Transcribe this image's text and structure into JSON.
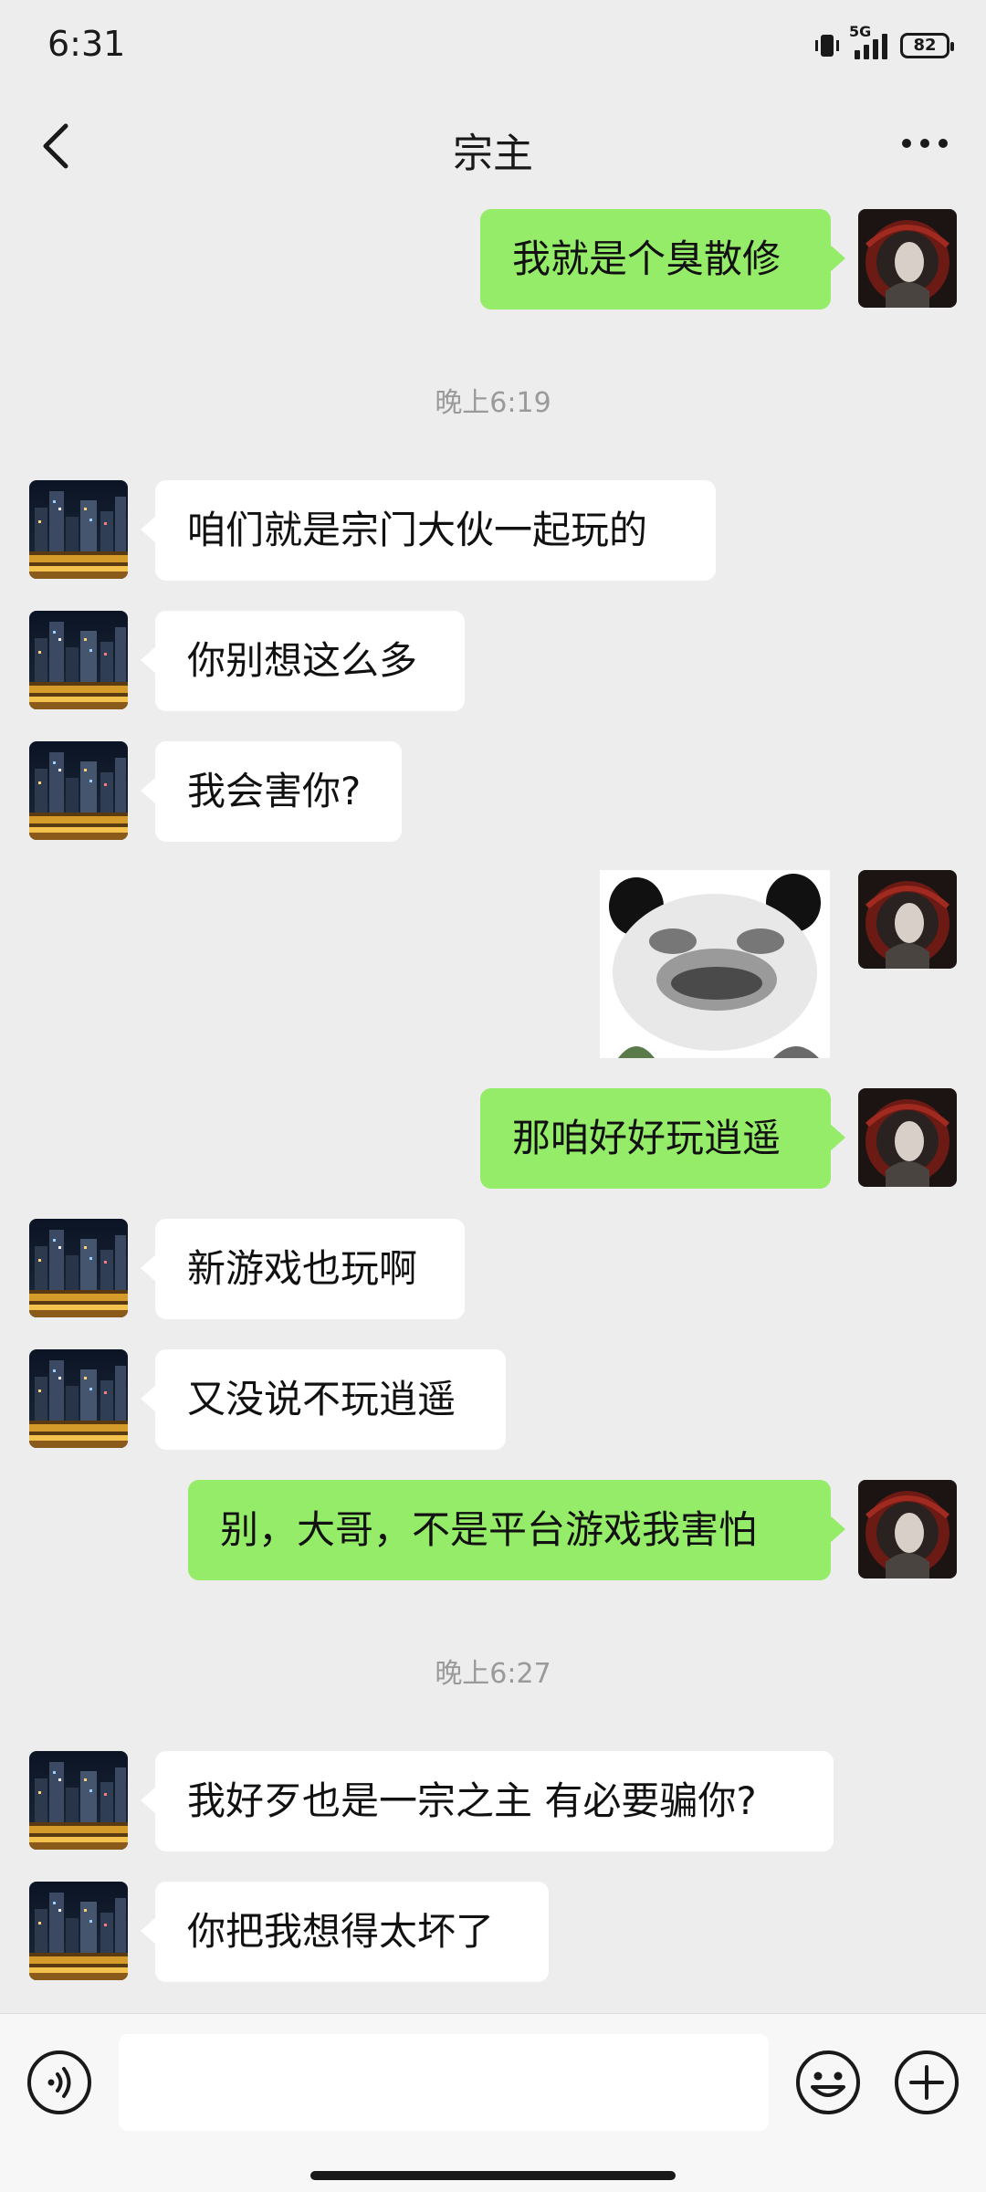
{
  "status_bar": {
    "time": "6:31",
    "network": "5G",
    "battery": "82"
  },
  "header": {
    "title": "宗主"
  },
  "messages": [
    {
      "side": "right",
      "text": "我就是个臭散修"
    },
    {
      "timestamp": "晚上6:19"
    },
    {
      "side": "left",
      "text": "咱们就是宗门大伙一起玩的"
    },
    {
      "side": "left",
      "text": "你别想这么多"
    },
    {
      "side": "left",
      "text": "我会害你?"
    },
    {
      "side": "right",
      "sticker": "panda-face-sticker"
    },
    {
      "side": "right",
      "text": "那咱好好玩逍遥"
    },
    {
      "side": "left",
      "text": "新游戏也玩啊"
    },
    {
      "side": "left",
      "text": "又没说不玩逍遥"
    },
    {
      "side": "right",
      "text": "别，大哥，不是平台游戏我害怕"
    },
    {
      "timestamp": "晚上6:27"
    },
    {
      "side": "left",
      "text": "我好歹也是一宗之主 有必要骗你?"
    },
    {
      "side": "left",
      "text": "你把我想得太坏了"
    }
  ],
  "input_bar": {
    "voice_icon": "voice-icon",
    "emoji_icon": "emoji-icon",
    "plus_icon": "plus-icon",
    "text_value": ""
  },
  "colors": {
    "background": "#ededed",
    "sent_bubble": "#95ec69",
    "received_bubble": "#ffffff",
    "timestamp": "#9a9a9a"
  }
}
